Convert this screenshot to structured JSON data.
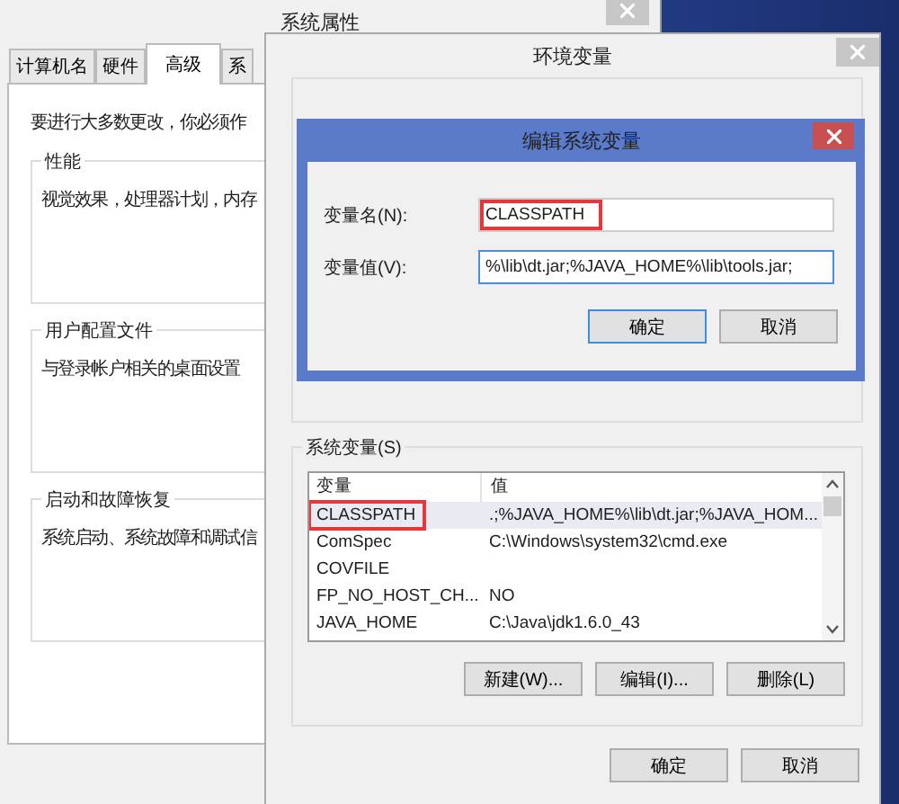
{
  "system_properties": {
    "title": "系统属性",
    "tabs": [
      {
        "label": "计算机名",
        "selected": false
      },
      {
        "label": "硬件",
        "selected": false
      },
      {
        "label": "高级",
        "selected": true
      },
      {
        "label": "系",
        "selected": false
      }
    ],
    "intro": "要进行大多数更改，你必须作",
    "groups": [
      {
        "title": "性能",
        "text": "视觉效果，处理器计划，内存"
      },
      {
        "title": "用户配置文件",
        "text": "与登录帐户相关的桌面设置"
      },
      {
        "title": "启动和故障恢复",
        "text": "系统启动、系统故障和调试信"
      }
    ]
  },
  "environment_variables": {
    "title": "环境变量",
    "system_variables": {
      "title": "系统变量(S)",
      "columns": [
        "变量",
        "值"
      ],
      "rows": [
        {
          "name": "CLASSPATH",
          "value": ".;%JAVA_HOME%\\lib\\dt.jar;%JAVA_HOM...",
          "selected": true,
          "highlighted": true
        },
        {
          "name": "ComSpec",
          "value": "C:\\Windows\\system32\\cmd.exe",
          "selected": false,
          "highlighted": false
        },
        {
          "name": "COVFILE",
          "selected": false,
          "highlighted": false
        },
        {
          "name": "FP_NO_HOST_CH...",
          "value": "NO",
          "selected": false,
          "highlighted": false
        },
        {
          "name": "JAVA_HOME",
          "value": "C:\\Java\\jdk1.6.0_43",
          "selected": false,
          "highlighted": false
        }
      ],
      "buttons": [
        "新建(W)...",
        "编辑(I)...",
        "删除(L)"
      ]
    },
    "buttons": [
      "确定",
      "取消"
    ]
  },
  "edit_dialog": {
    "title": "编辑系统变量",
    "fields": [
      {
        "label": "变量名(N):",
        "value": "CLASSPATH",
        "focused": false,
        "highlighted": true
      },
      {
        "label": "变量值(V):",
        "value": "%\\lib\\dt.jar;%JAVA_HOME%\\lib\\tools.jar;",
        "focused": true,
        "highlighted": false
      }
    ],
    "buttons": [
      {
        "label": "确定",
        "default": true
      },
      {
        "label": "取消",
        "default": false
      }
    ]
  }
}
